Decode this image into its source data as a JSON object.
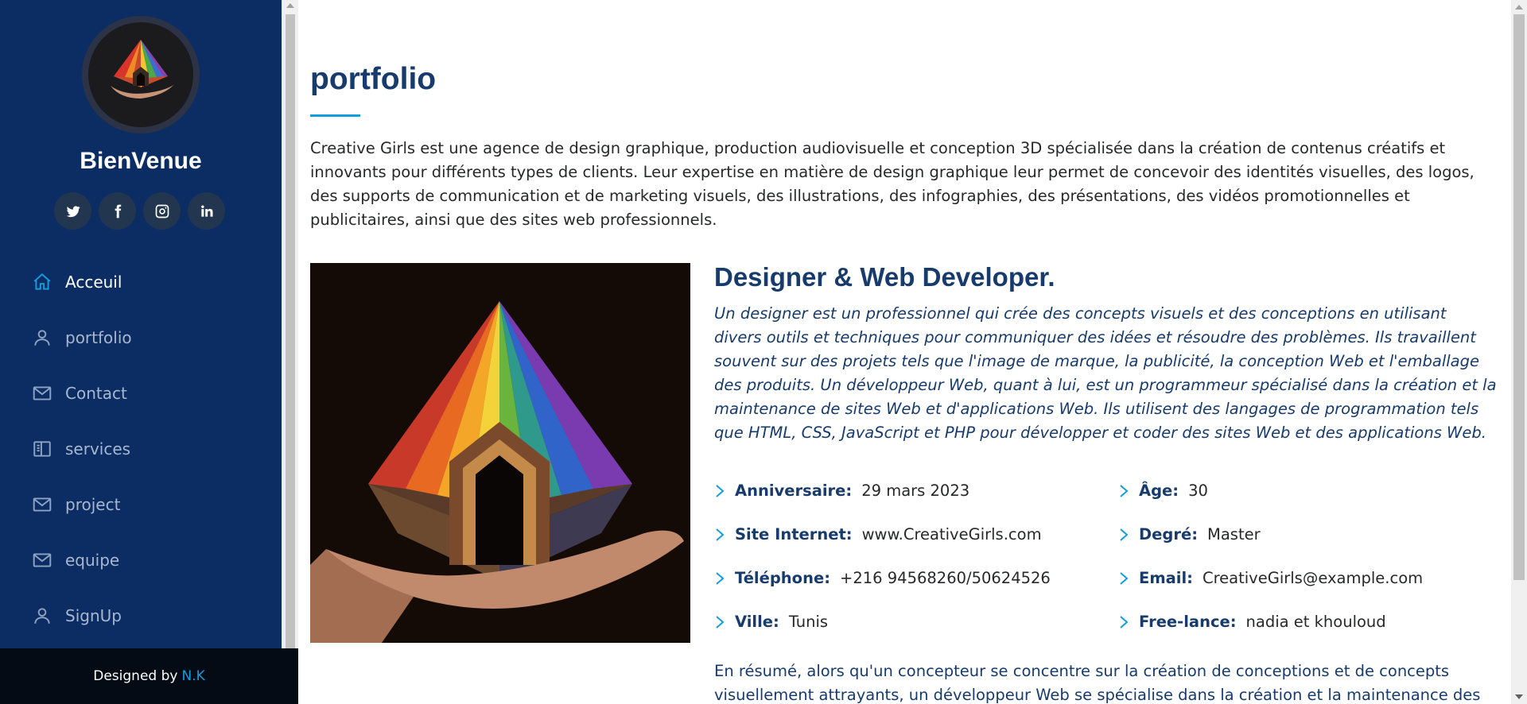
{
  "sidebar": {
    "brand": "BienVenue",
    "socials": [
      {
        "icon": "twitter-icon"
      },
      {
        "icon": "facebook-icon"
      },
      {
        "icon": "instagram-icon"
      },
      {
        "icon": "linkedin-icon"
      }
    ],
    "nav": [
      {
        "label": "Acceuil",
        "icon": "home-icon",
        "active": true
      },
      {
        "label": "portfolio",
        "icon": "user-icon"
      },
      {
        "label": "Contact",
        "icon": "envelope-icon"
      },
      {
        "label": "services",
        "icon": "book-icon"
      },
      {
        "label": "project",
        "icon": "envelope-icon"
      },
      {
        "label": "equipe",
        "icon": "envelope-icon"
      },
      {
        "label": "SignUp",
        "icon": "user-icon"
      }
    ],
    "footer": {
      "prefix": "Designed by",
      "author": "N.K"
    }
  },
  "main": {
    "title": "portfolio",
    "intro": "Creative Girls est une agence de design graphique, production audiovisuelle et conception 3D spécialisée dans la création de contenus créatifs et innovants pour différents types de clients. Leur expertise en matière de design graphique leur permet de concevoir des identités visuelles, des logos, des supports de communication et de marketing visuels, des illustrations, des infographies, des présentations, des vidéos promotionnelles et publicitaires, ainsi que des sites web professionnels.",
    "role": "Designer & Web Developer.",
    "description": "Un designer est un professionnel qui crée des concepts visuels et des conceptions en utilisant divers outils et techniques pour communiquer des idées et résoudre des problèmes. Ils travaillent souvent sur des projets tels que l'image de marque, la publicité, la conception Web et l'emballage des produits. Un développeur Web, quant à lui, est un programmeur spécialisé dans la création et la maintenance de sites Web et d'applications Web. Ils utilisent des langages de programmation tels que HTML, CSS, JavaScript et PHP pour développer et coder des sites Web et des applications Web.",
    "info": {
      "birthday": {
        "k": "Anniversaire:",
        "v": "29 mars 2023"
      },
      "age": {
        "k": "Âge:",
        "v": "30"
      },
      "website": {
        "k": "Site Internet:",
        "v": "www.CreativeGirls.com"
      },
      "degree": {
        "k": "Degré:",
        "v": "Master"
      },
      "phone": {
        "k": "Téléphone:",
        "v": "+216 94568260/50624526"
      },
      "email": {
        "k": "Email:",
        "v": "CreativeGirls@example.com"
      },
      "city": {
        "k": "Ville:",
        "v": "Tunis"
      },
      "freelance": {
        "k": "Free-lance:",
        "v": "nadia et khouloud"
      }
    },
    "summary": "En résumé, alors qu'un concepteur se concentre sur la création de conceptions et de concepts visuellement attrayants, un développeur Web se spécialise dans la création et la maintenance des"
  },
  "colors": {
    "sidebar": "#0b2d63",
    "accent": "#149ddd",
    "heading": "#173b6c",
    "footer": "#040b14"
  }
}
